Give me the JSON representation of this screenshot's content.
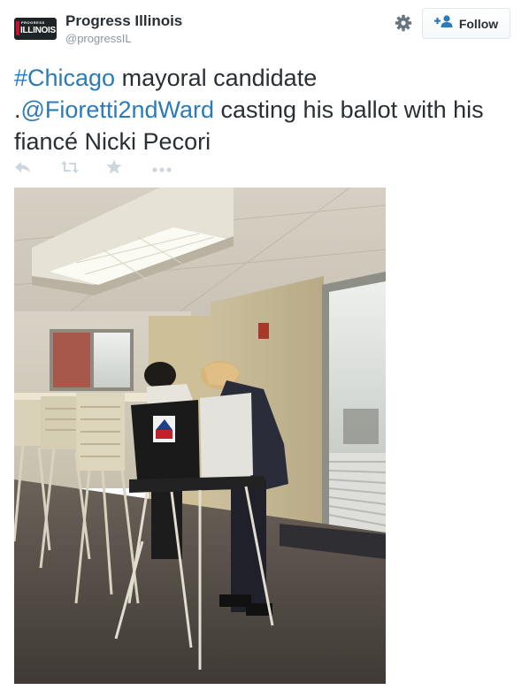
{
  "account": {
    "display_name": "Progress Illinois",
    "handle": "@progressIL",
    "avatar_text_small": "PROGRESS",
    "avatar_text_big": "ILLINOIS"
  },
  "header": {
    "settings_icon": "gear-icon",
    "follow_label": "Follow",
    "follow_icon": "add-user-icon"
  },
  "tweet": {
    "hashtag": "#Chicago",
    "text_1": " mayoral candidate",
    "prefix_dot": ".",
    "mention": "@Fioretti2ndWard",
    "text_2": " casting his ballot with his fiancé Nicki Pecori"
  },
  "actions": [
    {
      "name": "reply",
      "icon": "reply-icon"
    },
    {
      "name": "retweet",
      "icon": "retweet-icon"
    },
    {
      "name": "favorite",
      "icon": "star-icon"
    },
    {
      "name": "more",
      "icon": "more-icon"
    }
  ],
  "colors": {
    "link": "#2b7bb9",
    "text": "#292f33",
    "muted": "#8899a6",
    "icon": "#ccd6dd"
  }
}
